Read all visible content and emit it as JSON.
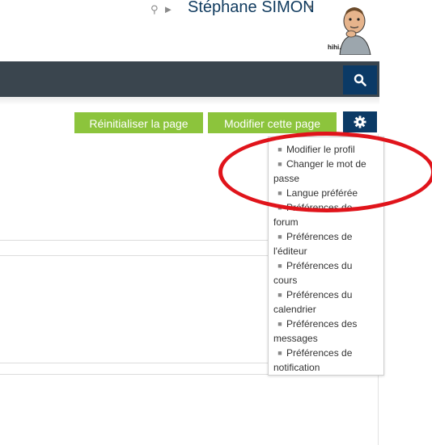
{
  "user": {
    "name": "Stéphane SIMON",
    "caret": "▾",
    "icons": [
      "notification-icon",
      "message-icon"
    ],
    "avatar_caption": "hihi."
  },
  "navbar": {
    "search_icon": "search-icon"
  },
  "actions": {
    "reset_label": "Réinitialiser la page",
    "edit_label": "Modifier cette page",
    "settings_icon": "gear-icon"
  },
  "menu": {
    "items": [
      {
        "label": "Modifier le profil"
      },
      {
        "label": "Changer le mot de passe"
      },
      {
        "label": "Langue préférée"
      },
      {
        "label": "Préférences de forum"
      },
      {
        "label": "Préférences de l'éditeur"
      },
      {
        "label": "Préférences du cours"
      },
      {
        "label": "Préférences du calendrier"
      },
      {
        "label": "Préférences des messages"
      },
      {
        "label": "Préférences de notification"
      }
    ]
  },
  "colors": {
    "nav": "#3a454e",
    "primary": "#0b3a66",
    "success": "#8cc43c",
    "highlight": "#e0141b"
  }
}
